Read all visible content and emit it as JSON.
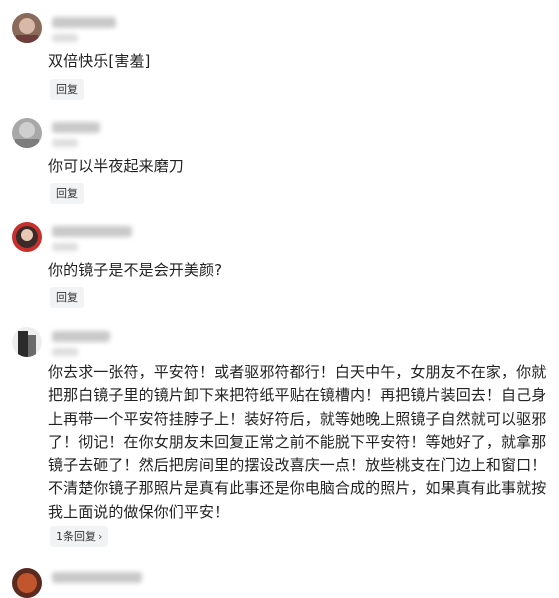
{
  "comments": [
    {
      "text": "双倍快乐[害羞]",
      "reply_label": "回复"
    },
    {
      "text": "你可以半夜起来磨刀",
      "reply_label": "回复"
    },
    {
      "text": "你的镜子是不是会开美颜?",
      "reply_label": "回复"
    },
    {
      "text": "你去求一张符，平安符！或者驱邪符都行！白天中午，女朋友不在家，你就把那白镜子里的镜片卸下来把符纸平贴在镜槽内！再把镜片装回去！自己身上再带一个平安符挂脖子上！装好符后，就等她晚上照镜子自然就可以驱邪了！彻记！在你女朋友未回复正常之前不能脱下平安符！等她好了，就拿那镜子去砸了！然后把房间里的摆设改喜庆一点！放些桃支在门边上和窗口！不清楚你镜子那照片是真有此事还是你电脑合成的照片，如果真有此事就按我上面说的做保你们平安！",
      "reply_label": "1条回复",
      "chevron": "›"
    }
  ],
  "colors": {
    "text": "#222222",
    "reply_bg": "#f2f3f5",
    "background": "#ffffff"
  }
}
